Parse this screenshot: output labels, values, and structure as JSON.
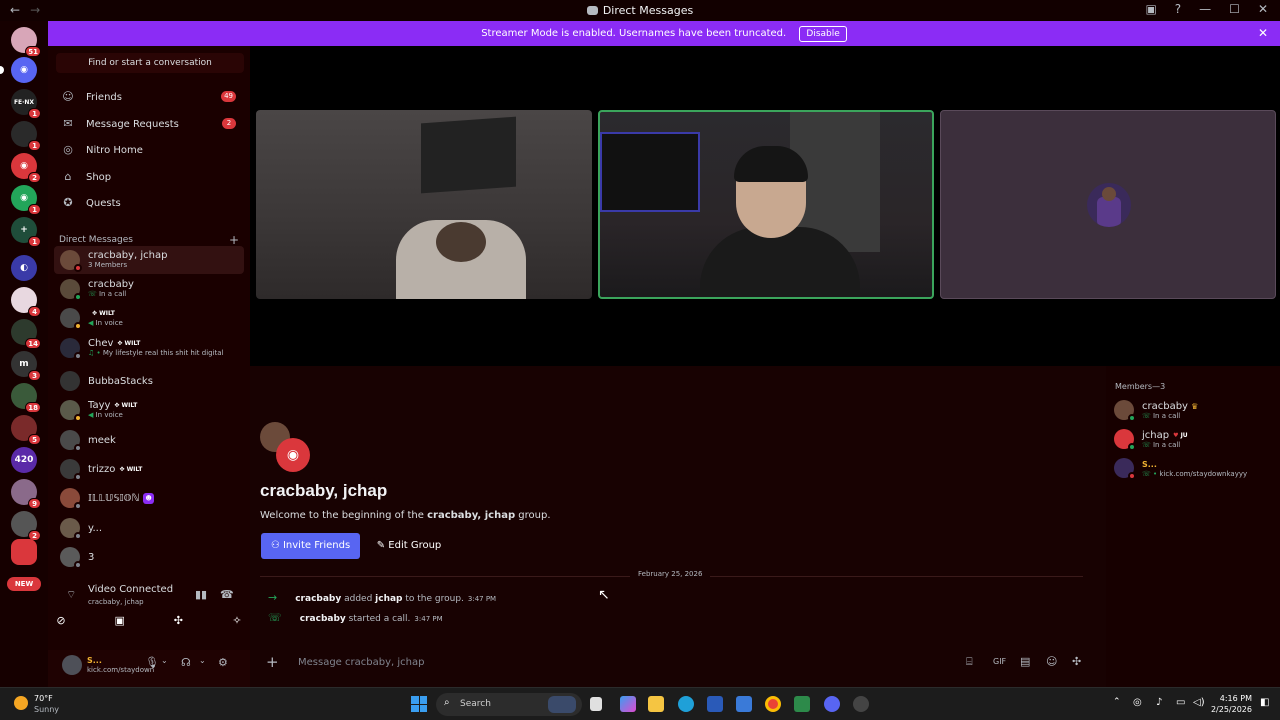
{
  "window": {
    "title": "Direct Messages"
  },
  "streamer": {
    "text": "Streamer Mode is enabled. Usernames have been truncated.",
    "button": "Disable"
  },
  "rail": {
    "badges": [
      "51",
      "1",
      "1",
      "2",
      "1",
      "1",
      "4",
      "14",
      "3",
      "18",
      "5",
      "9",
      "2"
    ],
    "mini_labels": [
      "FE·NX",
      "m"
    ],
    "new_label": "NEW"
  },
  "sidebar": {
    "search_placeholder": "Find or start a conversation",
    "nav": [
      {
        "label": "Friends",
        "icon": "friends-icon",
        "count": "49"
      },
      {
        "label": "Message Requests",
        "icon": "mail-icon",
        "count": "2"
      },
      {
        "label": "Nitro Home",
        "icon": "nitro-icon",
        "count": ""
      },
      {
        "label": "Shop",
        "icon": "shop-icon",
        "count": ""
      },
      {
        "label": "Quests",
        "icon": "quests-icon",
        "count": ""
      }
    ],
    "dm_header": "Direct Messages",
    "dms": [
      {
        "name": "cracbaby, jchap",
        "sub": "3 Members",
        "tag": ""
      },
      {
        "name": "cracbaby",
        "sub": "In a call",
        "tag": ""
      },
      {
        "name": "",
        "sub": "In voice",
        "tag": "WILT"
      },
      {
        "name": "Chev",
        "sub": "My lifestyle real this shit hit digital",
        "tag": "WILT"
      },
      {
        "name": "BubbaStacks",
        "sub": "",
        "tag": ""
      },
      {
        "name": "Tayy",
        "sub": "In voice",
        "tag": "WILT"
      },
      {
        "name": "meek",
        "sub": "",
        "tag": ""
      },
      {
        "name": "trizzo",
        "sub": "",
        "tag": "WILT"
      },
      {
        "name": "𝕀𝕃𝕃𝕌𝕊𝕀𝕆ℕ",
        "sub": "",
        "tag": ""
      },
      {
        "name": "y...",
        "sub": "",
        "tag": ""
      },
      {
        "name": "3",
        "sub": "",
        "tag": ""
      }
    ]
  },
  "voice": {
    "status": "Video Connected",
    "channel": "cracbaby, jchap"
  },
  "user": {
    "name": "S...",
    "status": "kick.com/staydown"
  },
  "group": {
    "title": "cracbaby, jchap",
    "welcome_prefix": "Welcome to the beginning of the ",
    "welcome_name": "cracbaby, jchap",
    "welcome_suffix": " group.",
    "invite_button": "Invite Friends",
    "edit_button": "Edit Group"
  },
  "messages": {
    "date": "February 25, 2026",
    "items": [
      {
        "user": "cracbaby",
        "text1": " added ",
        "target": "jchap",
        "text2": " to the group.",
        "time": "3:47 PM"
      },
      {
        "user": "cracbaby",
        "text1": " started a call.",
        "target": "",
        "text2": "",
        "time": "3:47 PM"
      }
    ],
    "composer_placeholder": "Message cracbaby, jchap"
  },
  "members": {
    "header": "Members—3",
    "list": [
      {
        "name": "cracbaby",
        "sub": "In a call",
        "tag": ""
      },
      {
        "name": "jchap",
        "sub": "In a call",
        "tag": "JU"
      },
      {
        "name": "S...",
        "sub": "kick.com/staydownkayyy",
        "tag": ""
      }
    ]
  },
  "taskbar": {
    "weather_temp": "70°F",
    "weather_desc": "Sunny",
    "search_label": "Search",
    "time": "4:16 PM",
    "date": "2/25/2026"
  },
  "colors": {
    "accent": "#5865f2",
    "streamer": "#8b2cf5",
    "online": "#23a55a",
    "badge": "#da373c"
  }
}
